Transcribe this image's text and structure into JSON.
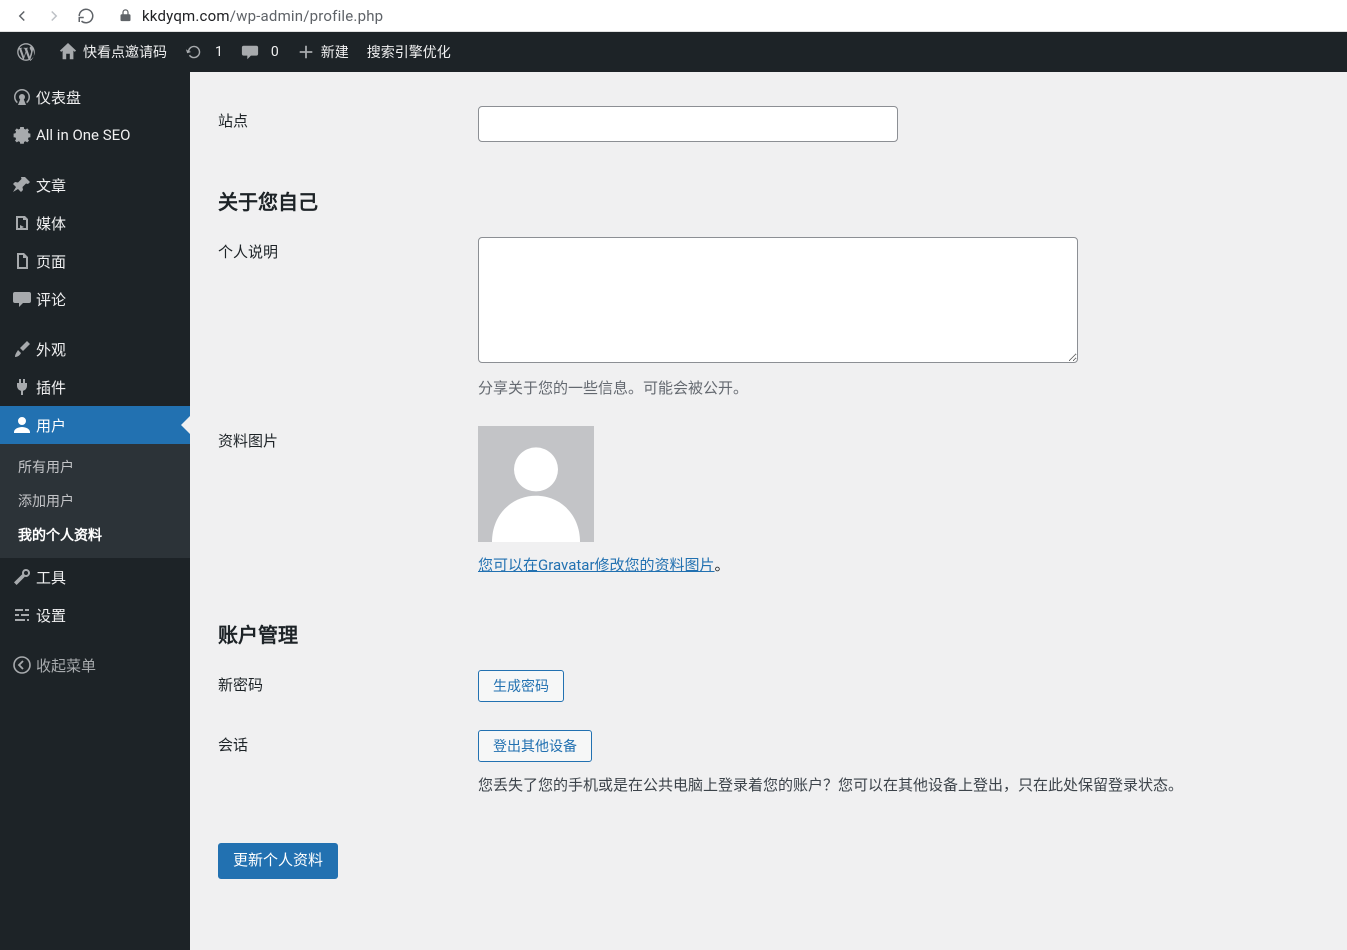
{
  "browser": {
    "host": "kkdyqm.com",
    "path": "/wp-admin/profile.php"
  },
  "adminbar": {
    "site_name": "快看点邀请码",
    "updates_count": "1",
    "comments_count": "0",
    "new_label": "新建",
    "seo_label": "搜索引擎优化"
  },
  "sidebar": {
    "dashboard": "仪表盘",
    "aioseo": "All in One SEO",
    "posts": "文章",
    "media": "媒体",
    "pages": "页面",
    "comments": "评论",
    "appearance": "外观",
    "plugins": "插件",
    "users": "用户",
    "users_sub": {
      "all": "所有用户",
      "add": "添加用户",
      "profile": "我的个人资料"
    },
    "tools": "工具",
    "settings": "设置",
    "collapse": "收起菜单"
  },
  "form": {
    "website_label": "站点",
    "website_value": "",
    "about_heading": "关于您自己",
    "bio_label": "个人说明",
    "bio_value": "",
    "bio_desc": "分享关于您的一些信息。可能会被公开。",
    "avatar_label": "资料图片",
    "gravatar_link_text": "您可以在Gravatar修改您的资料图片",
    "gravatar_link_suffix": "。",
    "account_heading": "账户管理",
    "newpass_label": "新密码",
    "genpass_button": "生成密码",
    "sessions_label": "会话",
    "sessions_button": "登出其他设备",
    "sessions_desc": "您丢失了您的手机或是在公共电脑上登录着您的账户？您可以在其他设备上登出，只在此处保留登录状态。",
    "submit_button": "更新个人资料"
  }
}
